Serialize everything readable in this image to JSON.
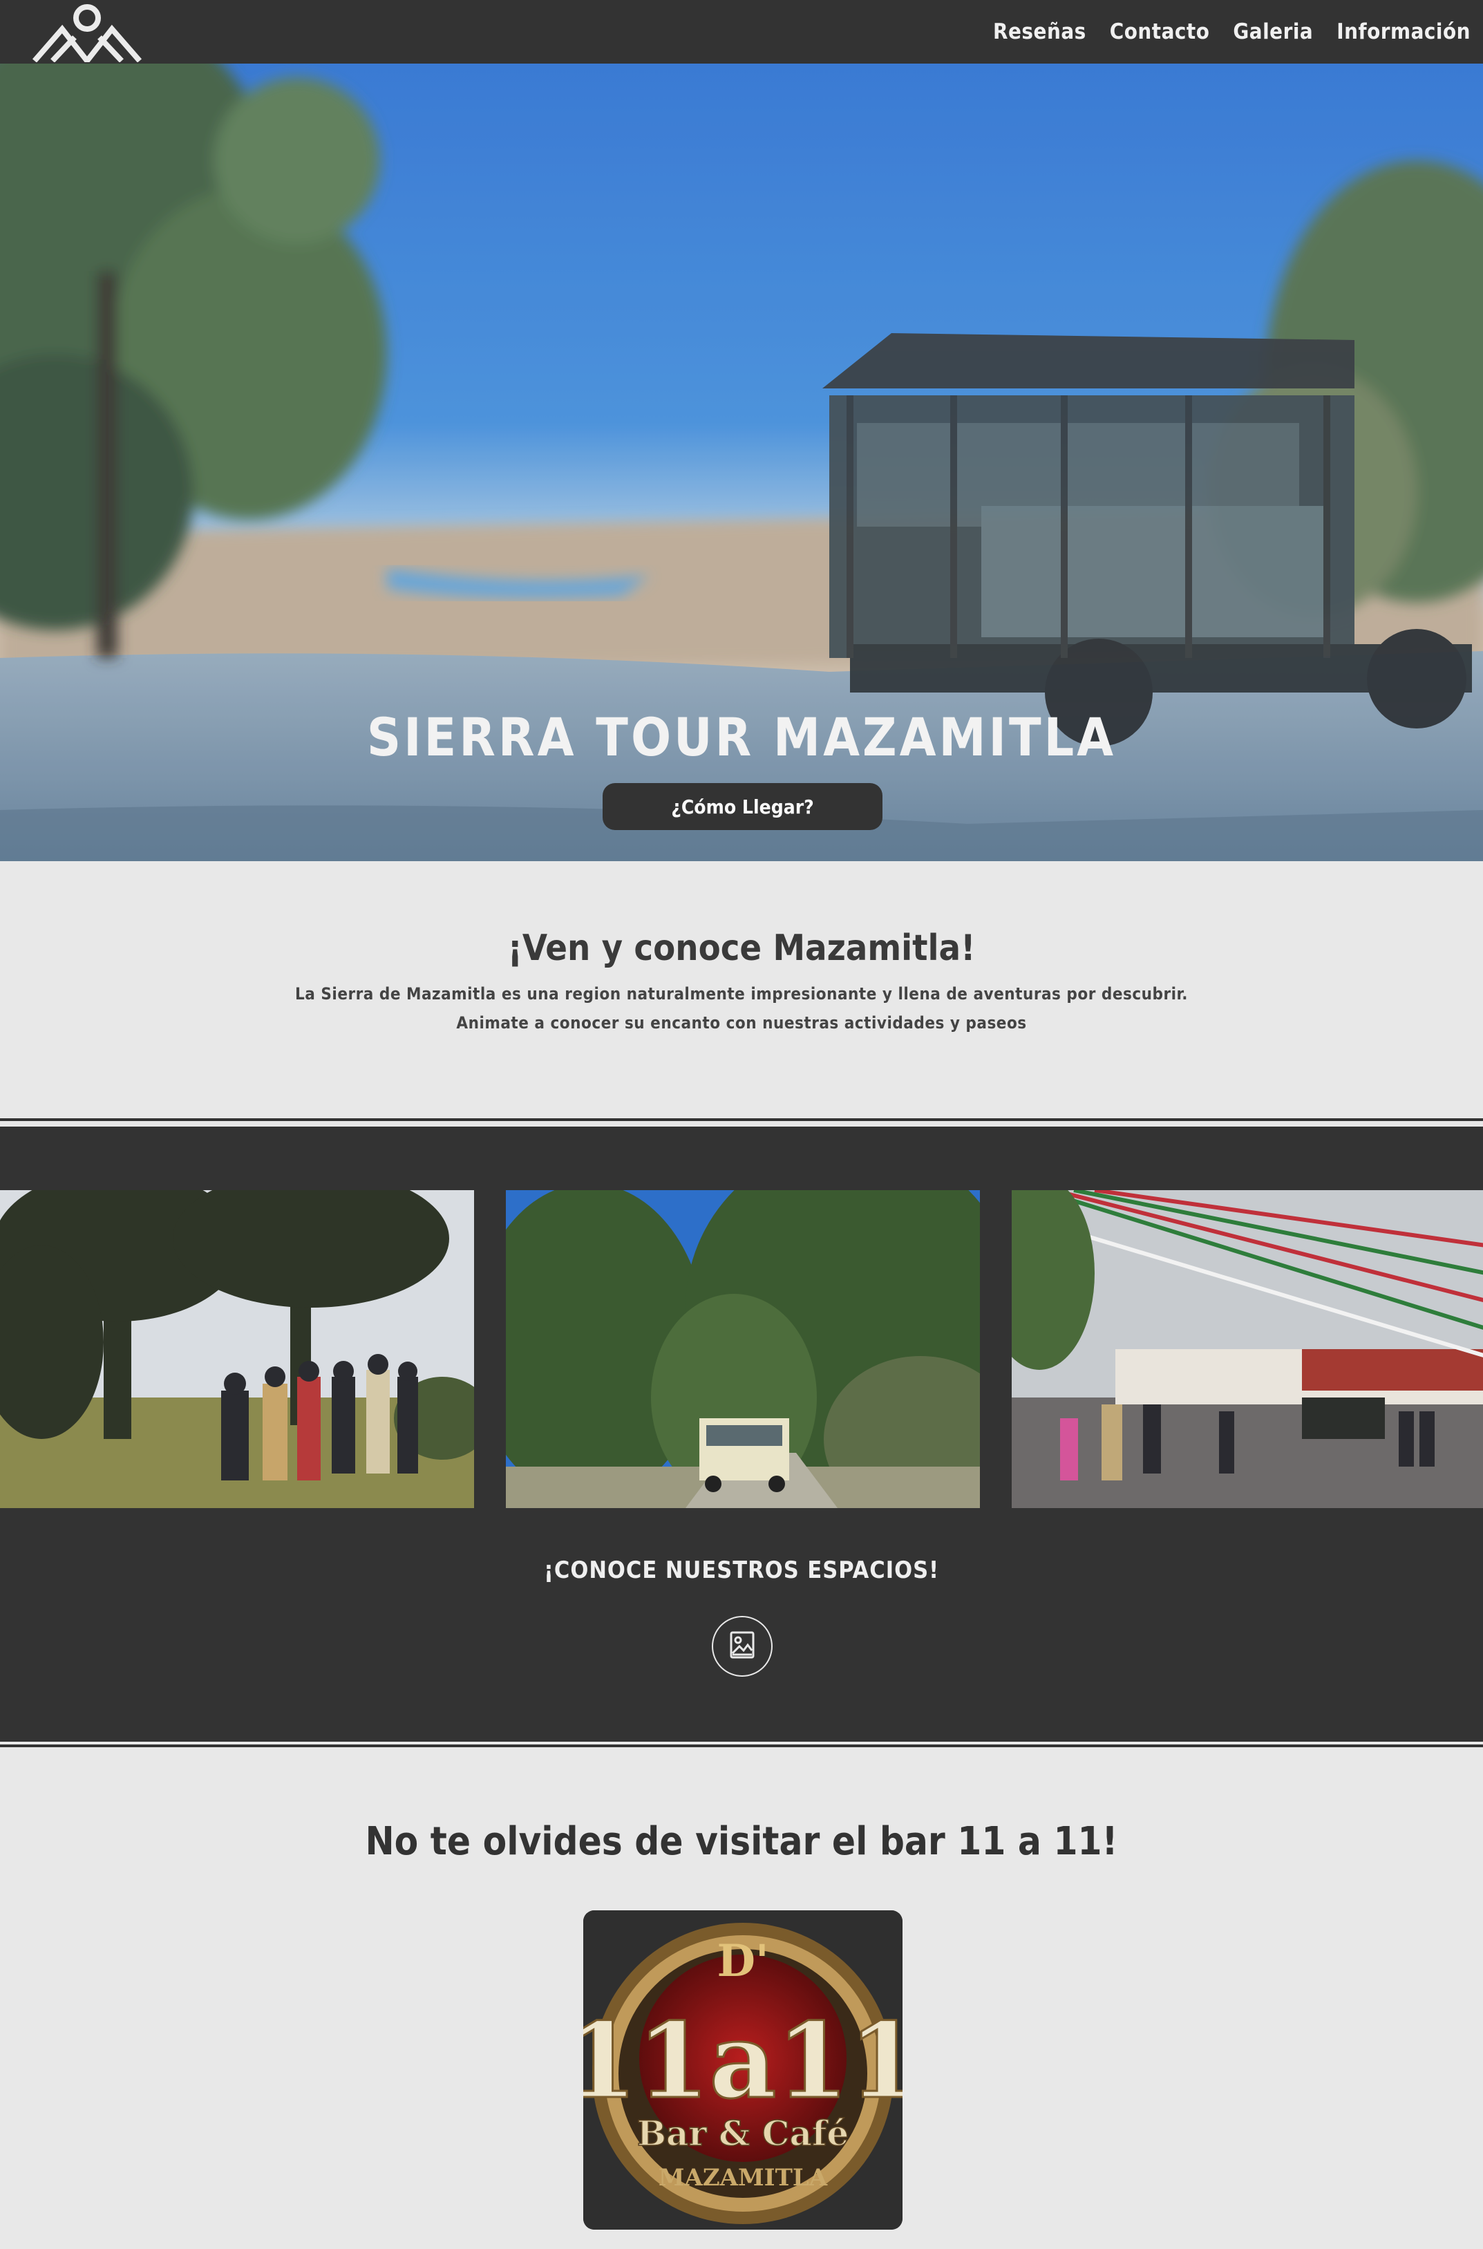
{
  "nav": {
    "logo_name": "mountain-logo",
    "links": [
      "Reseñas",
      "Contacto",
      "Galeria",
      "Información"
    ]
  },
  "hero": {
    "title": "SIERRA TOUR MAZAMITLA",
    "button": "¿Cómo Llegar?"
  },
  "intro": {
    "heading": "¡Ven y conoce Mazamitla!",
    "line1": "La Sierra de Mazamitla es una region naturalmente impresionante y llena de aventuras por descubrir.",
    "line2": "Animate a conocer su encanto con nuestras actividades y paseos"
  },
  "gallery": {
    "title": "¡CONOCE NUESTROS ESPACIOS!",
    "button_icon": "gallery-icon"
  },
  "bar": {
    "heading": "No te olvides de visitar el bar 11 a 11!",
    "logo": {
      "top": "D'",
      "main": "11a11",
      "sub": "Bar & Café",
      "place": "MAZAMITLA"
    }
  },
  "colors": {
    "dark": "#333333",
    "light_bg": "#e8e8e8"
  }
}
